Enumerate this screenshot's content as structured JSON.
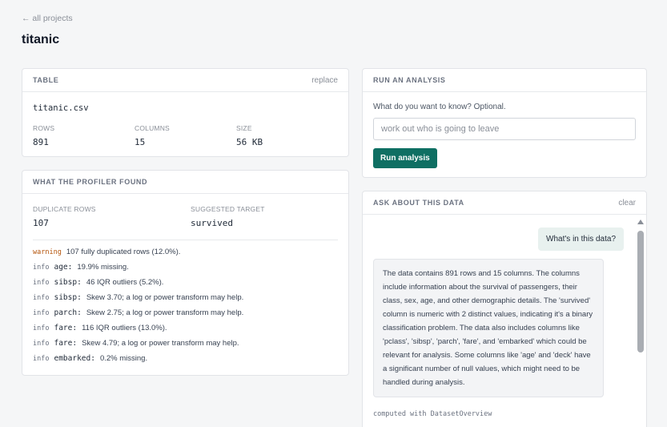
{
  "nav": {
    "back": "← all projects"
  },
  "page": {
    "title": "titanic"
  },
  "table_card": {
    "title": "TABLE",
    "action": "replace",
    "filename": "titanic.csv",
    "stats": [
      {
        "label": "ROWS",
        "value": "891"
      },
      {
        "label": "COLUMNS",
        "value": "15"
      },
      {
        "label": "SIZE",
        "value": "56 KB"
      }
    ]
  },
  "profiler_card": {
    "title": "WHAT THE PROFILER FOUND",
    "duplicate_label": "DUPLICATE ROWS",
    "duplicate_value": "107",
    "target_label": "SUGGESTED TARGET",
    "target_value": "survived",
    "findings": [
      {
        "level": "warning",
        "column": "",
        "text": "107 fully duplicated rows (12.0%)."
      },
      {
        "level": "info",
        "column": "age:",
        "text": "19.9% missing."
      },
      {
        "level": "info",
        "column": "sibsp:",
        "text": "46 IQR outliers (5.2%)."
      },
      {
        "level": "info",
        "column": "sibsp:",
        "text": "Skew 3.70; a log or power transform may help."
      },
      {
        "level": "info",
        "column": "parch:",
        "text": "Skew 2.75; a log or power transform may help."
      },
      {
        "level": "info",
        "column": "fare:",
        "text": "116 IQR outliers (13.0%)."
      },
      {
        "level": "info",
        "column": "fare:",
        "text": "Skew 4.79; a log or power transform may help."
      },
      {
        "level": "info",
        "column": "embarked:",
        "text": "0.2% missing."
      }
    ]
  },
  "analysis_card": {
    "title": "RUN AN ANALYSIS",
    "question_label": "What do you want to know? Optional.",
    "input_value": "",
    "input_placeholder": "work out who is going to leave",
    "run_button": "Run analysis"
  },
  "chat_card": {
    "title": "ASK ABOUT THIS DATA",
    "action": "clear",
    "user_message": "What's in this data?",
    "assistant_message": "The data contains 891 rows and 15 columns. The columns include information about the survival of passengers, their class, sex, age, and other demographic details. The 'survived' column is numeric with 2 distinct values, indicating it's a binary classification problem. The data also includes columns like 'pclass', 'sibsp', 'parch', 'fare', and 'embarked' which could be relevant for analysis. Some columns like 'age' and 'deck' have a significant number of null values, which might need to be handled during analysis.",
    "computed_note": "computed with DatasetOverview"
  },
  "colors": {
    "accent": "#0f6f63",
    "warning": "#b45309",
    "user_bubble": "#e8f1ef",
    "background": "#f5f6f7"
  }
}
